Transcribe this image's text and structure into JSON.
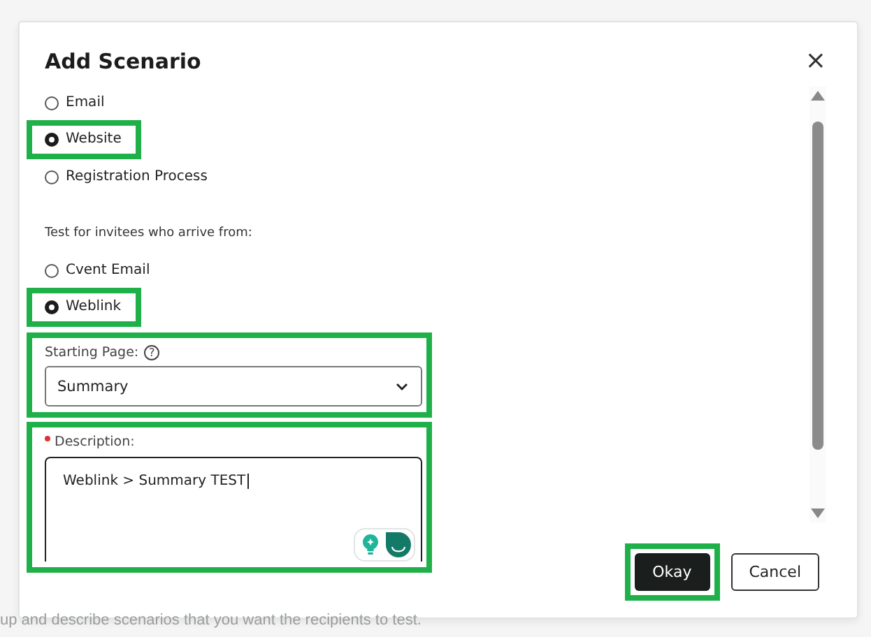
{
  "background": {
    "note": "up and describe scenarios that you want the recipients to test."
  },
  "dialog": {
    "title": "Add Scenario",
    "close": "×",
    "scenario_types": [
      {
        "label": "Email",
        "selected": false,
        "highlighted": false
      },
      {
        "label": "Website",
        "selected": true,
        "highlighted": true
      },
      {
        "label": "Registration Process",
        "selected": false,
        "highlighted": false
      }
    ],
    "arrival_prompt": "Test for invitees who arrive from:",
    "arrival_sources": [
      {
        "label": "Cvent Email",
        "selected": false,
        "highlighted": false
      },
      {
        "label": "Weblink",
        "selected": true,
        "highlighted": true
      }
    ],
    "starting_page": {
      "label": "Starting Page:",
      "help": "?",
      "value": "Summary",
      "highlighted": true
    },
    "description": {
      "label": "Description:",
      "required": true,
      "value": "Weblink > Summary TEST",
      "highlighted": true
    },
    "buttons": [
      {
        "label": "Okay",
        "kind": "primary",
        "highlighted": true
      },
      {
        "label": "Cancel",
        "kind": "secondary",
        "highlighted": false
      }
    ]
  }
}
